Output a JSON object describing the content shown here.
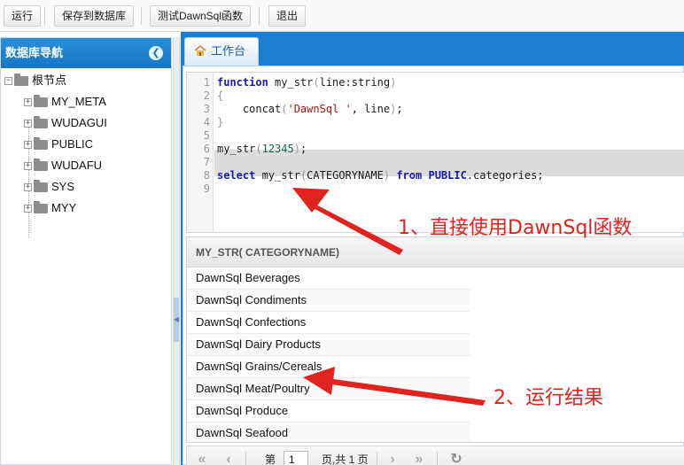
{
  "toolbar": {
    "run_label": "运行",
    "save_label": "保存到数据库",
    "test_label": "测试DawnSql函数",
    "exit_label": "退出"
  },
  "nav": {
    "title": "数据库导航",
    "collapse_icon": "chevron-left-icon",
    "root_label": "根节点",
    "items": [
      {
        "label": "MY_META"
      },
      {
        "label": "WUDAGUI"
      },
      {
        "label": "PUBLIC"
      },
      {
        "label": "WUDAFU"
      },
      {
        "label": "SYS"
      },
      {
        "label": "MYY"
      }
    ]
  },
  "workspace": {
    "tab_label": "工作台",
    "tab_icon": "home-icon",
    "accent_color": "#1a7fd0"
  },
  "editor": {
    "line_numbers": [
      "1",
      "2",
      "3",
      "4",
      "5",
      "6",
      "7",
      "8",
      "9"
    ],
    "lines": {
      "l1_kw": "function",
      "l1_name": " my_str",
      "l1_open": "(",
      "l1_params": "line:string",
      "l1_close": ")",
      "l2": "{",
      "l3_fn": "    concat",
      "l3_open": "(",
      "l3_str": "'DawnSql '",
      "l3_rest": ", line",
      "l3_close": ")",
      "l3_end": ";",
      "l4": "}",
      "l6_name": "my_str",
      "l6_open": "(",
      "l6_num": "12345",
      "l6_close": ")",
      "l6_end": ";",
      "l8_kw1": "select",
      "l8_name": " my_str",
      "l8_open": "(",
      "l8_col": "CATEGORYNAME",
      "l8_close": ")",
      "l8_kw2": " from ",
      "l8_schema": "PUBLIC",
      "l8_table": ".categories;"
    }
  },
  "grid": {
    "column_header": "MY_STR( CATEGORYNAME)",
    "rows": [
      "DawnSql Beverages",
      "DawnSql Condiments",
      "DawnSql Confections",
      "DawnSql Dairy Products",
      "DawnSql Grains/Cereals",
      "DawnSql Meat/Poultry",
      "DawnSql Produce",
      "DawnSql Seafood"
    ]
  },
  "pager": {
    "first_icon": "double-chevron-left-icon",
    "prev_icon": "chevron-left-icon",
    "page_prefix": "第",
    "page_value": "1",
    "page_suffix": "页,共 1 页",
    "next_icon": "chevron-right-icon",
    "last_icon": "double-chevron-right-icon",
    "refresh_icon": "refresh-icon"
  },
  "annotations": {
    "note1": "1、直接使用DawnSql函数",
    "note2": "2、运行结果",
    "color": "#e0231f"
  }
}
